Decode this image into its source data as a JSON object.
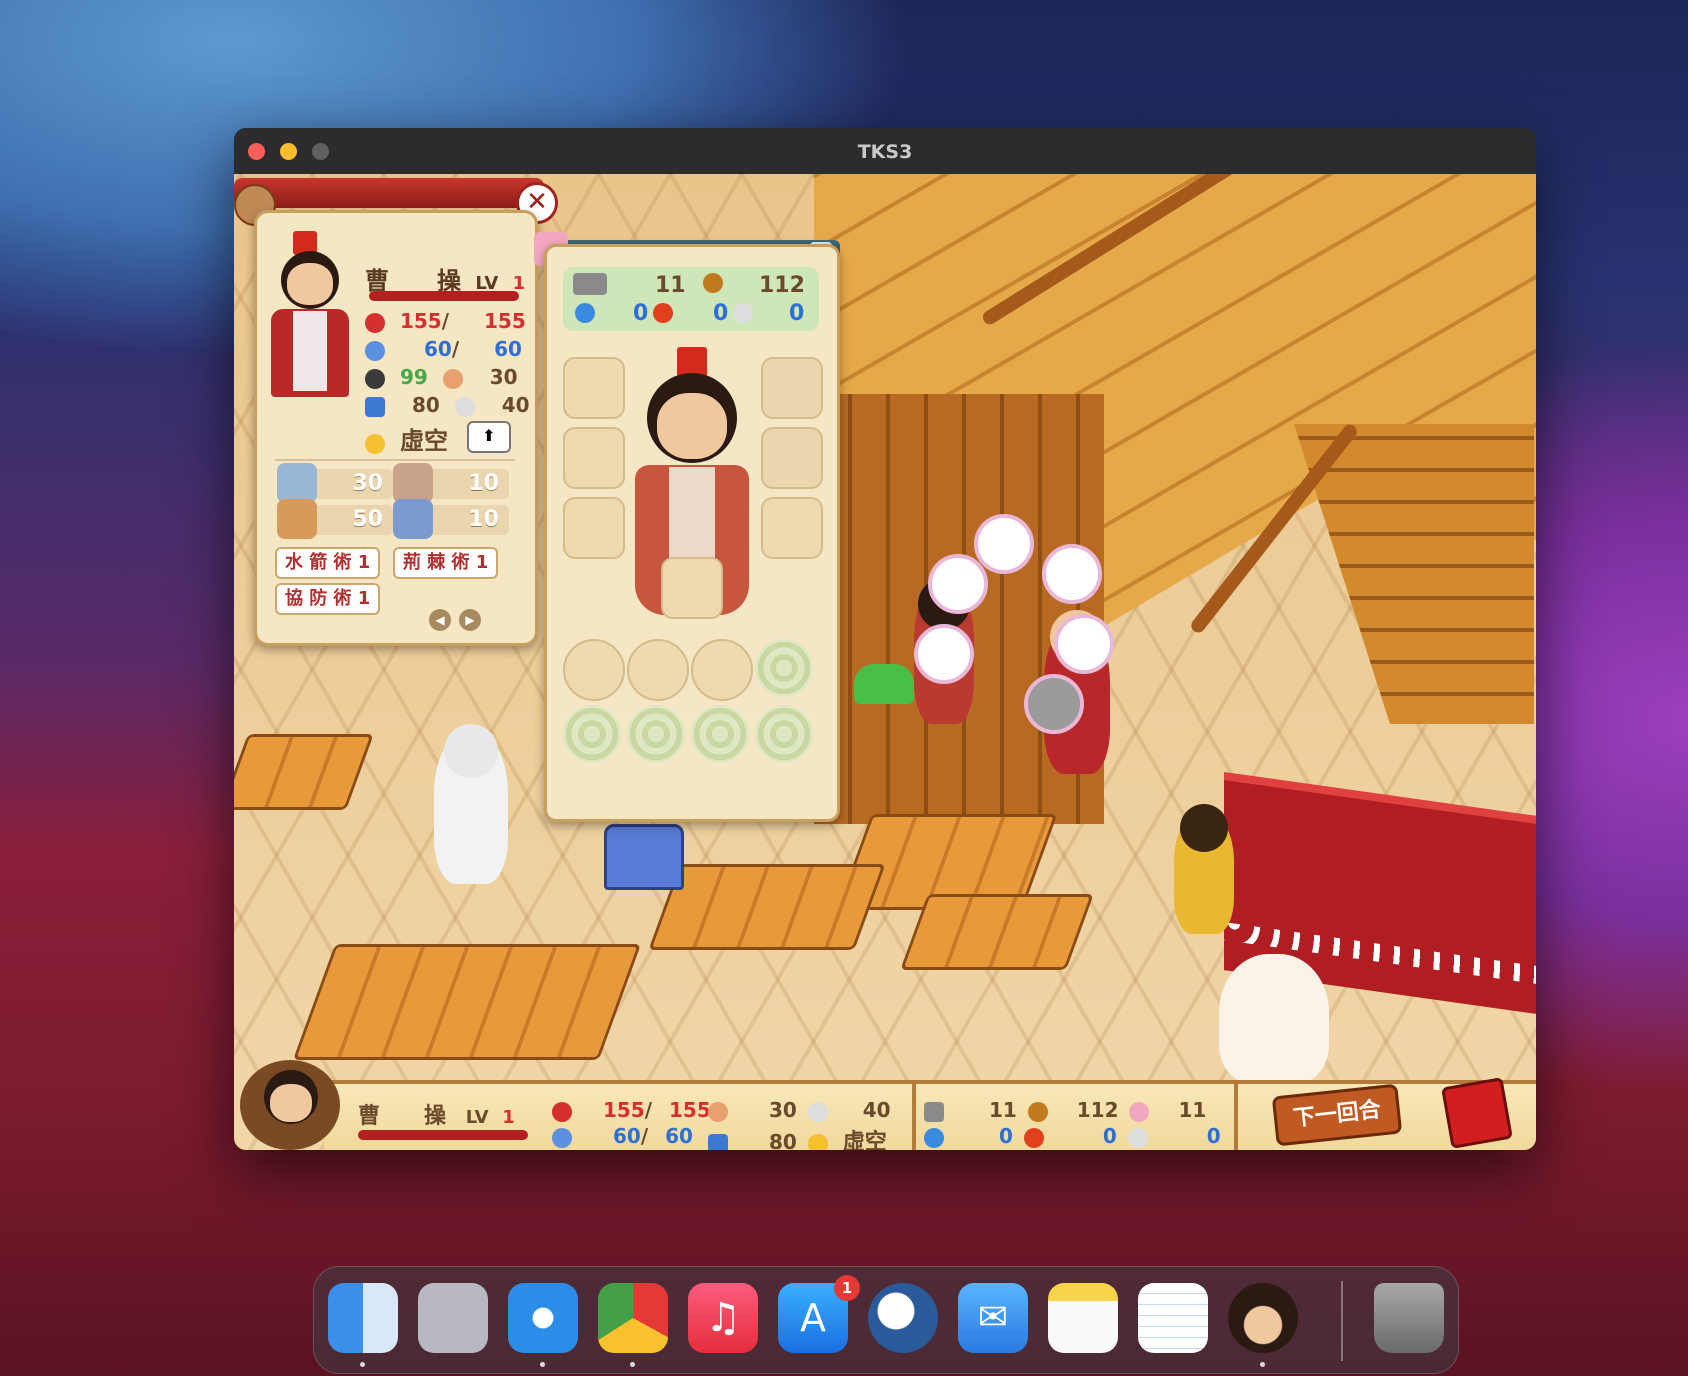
{
  "window": {
    "title": "TKS3"
  },
  "character": {
    "name": "曹　　操",
    "level_label": "LV",
    "level": "1",
    "hp": "155",
    "hp_max": "155",
    "mp": "60",
    "mp_max": "60",
    "stat_a": "99",
    "stat_b": "30",
    "stat_c": "80",
    "stat_d": "40",
    "element": "虛空",
    "weapon_skills": [
      "30",
      "10",
      "50",
      "10"
    ],
    "arts": [
      "水 箭 術 1",
      "荊 棘 術 1",
      "協 防 術 1"
    ]
  },
  "equipment": {
    "atk": "11",
    "def": "112",
    "water": "0",
    "fire": "0",
    "wind": "0"
  },
  "hud": {
    "name": "曹　　操",
    "level_label": "LV",
    "level": "1",
    "hp": "155",
    "hp_max": "155",
    "mp": "60",
    "mp_max": "60",
    "str": "30",
    "agi": "40",
    "spd": "80",
    "element": "虛空",
    "atk": "11",
    "def": "112",
    "misc": "11",
    "water": "0",
    "fire": "0",
    "wind": "0",
    "next_turn": "下一回合"
  },
  "dock": {
    "appstore_badge": "1",
    "apps": [
      "finder-icon",
      "launchpad-icon",
      "safari-icon",
      "chrome-icon",
      "music-icon",
      "appstore-icon",
      "tks-icon",
      "mail-icon",
      "notes-icon",
      "textedit-icon",
      "game-icon",
      "trash-icon"
    ]
  },
  "colors": {
    "hp": "#d6302e",
    "mp": "#2e6fd6",
    "panel": "#f5e6c4",
    "accent": "#b01e22"
  }
}
